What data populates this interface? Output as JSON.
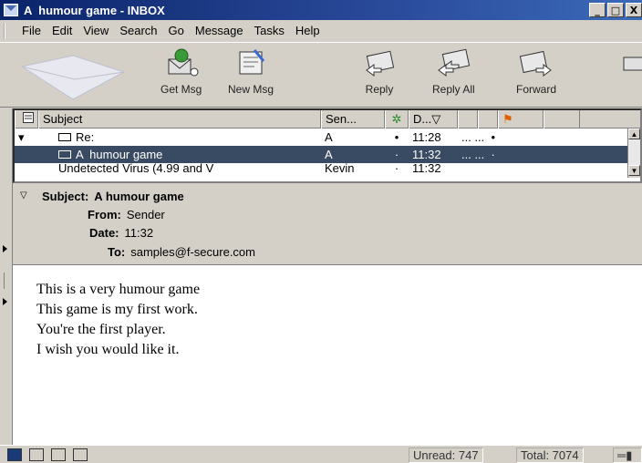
{
  "window": {
    "title": "A  humour game - INBOX",
    "controls": [
      "_",
      "□",
      "X"
    ]
  },
  "menu": [
    {
      "label": "File"
    },
    {
      "label": "Edit"
    },
    {
      "label": "View"
    },
    {
      "label": "Search"
    },
    {
      "label": "Go"
    },
    {
      "label": "Message"
    },
    {
      "label": "Tasks"
    },
    {
      "label": "Help"
    }
  ],
  "toolbar": {
    "get_msg": "Get Msg",
    "new_msg": "New Msg",
    "reply": "Reply",
    "reply_all": "Reply All",
    "forward": "Forward"
  },
  "thread": {
    "columns": {
      "subject": "Subject",
      "sender": "Sen...",
      "date": "D...▽"
    },
    "rows": [
      {
        "subject": "Re:",
        "sender": "A",
        "dot": "•",
        "time": "11:28",
        "extra": "... ...  •"
      },
      {
        "subject": "A  humour game",
        "sender": "A",
        "dot": "·",
        "time": "11:32",
        "extra": "... ...  ·"
      },
      {
        "subject": "Undetected Virus (4.99 and V",
        "sender": "Kevin",
        "dot": "·",
        "time": "11:32",
        "extra": ""
      }
    ]
  },
  "message": {
    "subject_label": "Subject:",
    "subject": "A humour game",
    "from_label": "From:",
    "from": "Sender",
    "date_label": "Date:",
    "date": "11:32",
    "to_label": "To:",
    "to": "samples@f-secure.com",
    "body": [
      "This is a very humour game",
      "This game is my first work.",
      "You're the first player.",
      "I wish you would like it."
    ]
  },
  "status": {
    "unread": "Unread: 747",
    "total": "Total: 7074"
  },
  "colors": {
    "titlebar": "#0a246a",
    "selection": "#394a63",
    "chrome": "#d4d0c8"
  }
}
